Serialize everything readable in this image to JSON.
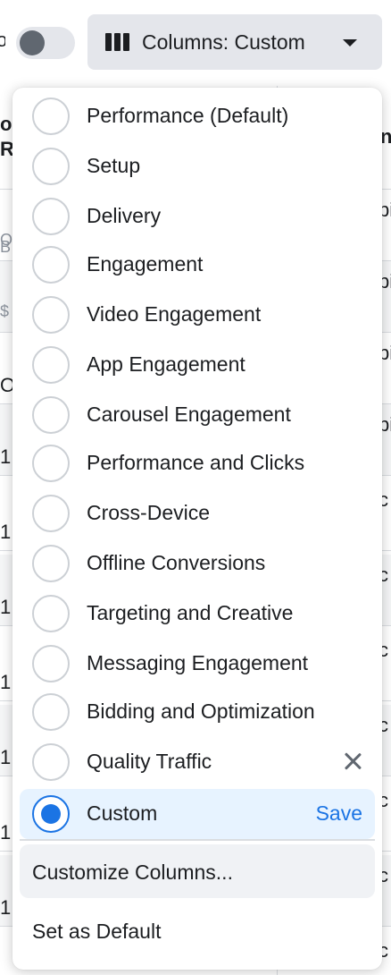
{
  "toolbar": {
    "toggle_label_fragment": "o",
    "toggle_on": false,
    "columns_button_label": "Columns: Custom"
  },
  "background": {
    "header_fragments": [
      "os",
      "R"
    ],
    "row_fragments": [
      "B",
      "O",
      "$",
      "O",
      "1,",
      "1,",
      "1,",
      "1,",
      "1,",
      "1,",
      "1,",
      "1,"
    ],
    "right_fragments": [
      "n",
      "pi",
      "pi",
      "pi",
      "pi",
      "c",
      "c",
      "c",
      "c",
      "c",
      "c",
      "c"
    ]
  },
  "menu": {
    "options": [
      {
        "label": "Performance (Default)",
        "selected": false
      },
      {
        "label": "Setup",
        "selected": false
      },
      {
        "label": "Delivery",
        "selected": false
      },
      {
        "label": "Engagement",
        "selected": false
      },
      {
        "label": "Video Engagement",
        "selected": false
      },
      {
        "label": "App Engagement",
        "selected": false
      },
      {
        "label": "Carousel Engagement",
        "selected": false
      },
      {
        "label": "Performance and Clicks",
        "selected": false
      },
      {
        "label": "Cross-Device",
        "selected": false
      },
      {
        "label": "Offline Conversions",
        "selected": false
      },
      {
        "label": "Targeting and Creative",
        "selected": false
      },
      {
        "label": "Messaging Engagement",
        "selected": false
      },
      {
        "label": "Bidding and Optimization",
        "selected": false
      },
      {
        "label": "Quality Traffic",
        "selected": false,
        "removable": true
      },
      {
        "label": "Custom",
        "selected": true
      }
    ],
    "save_label": "Save",
    "customize_label": "Customize Columns...",
    "set_default_label": "Set as Default"
  },
  "colors": {
    "accent": "#1b74e4",
    "selected_bg": "#e7f3ff",
    "text": "#1c1e21"
  }
}
